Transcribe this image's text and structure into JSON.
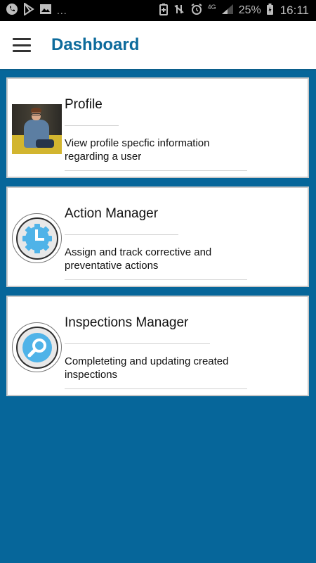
{
  "status_bar": {
    "dots": "...",
    "network": "4G",
    "battery_percent": "25%",
    "time": "16:11"
  },
  "app_bar": {
    "title": "Dashboard"
  },
  "cards": [
    {
      "title": "Profile",
      "description": "View profile specfic information regarding a user",
      "icon": "profile-photo"
    },
    {
      "title": "Action Manager",
      "description": "Assign and track corrective and preventative actions",
      "icon": "clock-gear-icon"
    },
    {
      "title": "Inspections Manager",
      "description": "Completeting and updating created inspections",
      "icon": "magnifier-icon"
    }
  ],
  "colors": {
    "background": "#06669a",
    "title": "#0d6b9c",
    "icon_blue": "#4fb3e8"
  }
}
